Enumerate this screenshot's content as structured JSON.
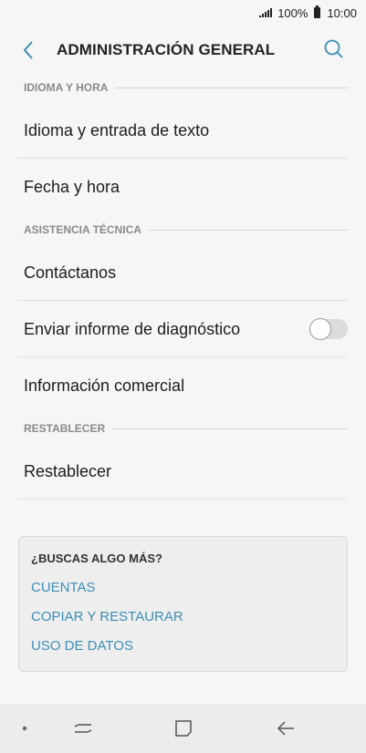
{
  "status_bar": {
    "battery": "100%",
    "time": "10:00"
  },
  "app_bar": {
    "title": "ADMINISTRACIÓN GENERAL"
  },
  "sections": [
    {
      "header": "IDIOMA Y HORA",
      "items": [
        "Idioma y entrada de texto",
        "Fecha y hora"
      ]
    },
    {
      "header": "ASISTENCIA TÉCNICA",
      "items": [
        "Contáctanos",
        "Enviar informe de diagnóstico",
        "Información comercial"
      ]
    },
    {
      "header": "RESTABLECER",
      "items": [
        "Restablecer"
      ]
    }
  ],
  "diagnostic_toggle": {
    "on": false
  },
  "more": {
    "title": "¿BUSCAS ALGO MÁS?",
    "links": [
      "CUENTAS",
      "COPIAR Y RESTAURAR",
      "USO DE DATOS"
    ]
  },
  "colors": {
    "accent": "#3c8fb3",
    "background": "#f6f6f6"
  },
  "icons": {
    "back": "chevron-left-icon",
    "search": "search-icon"
  }
}
